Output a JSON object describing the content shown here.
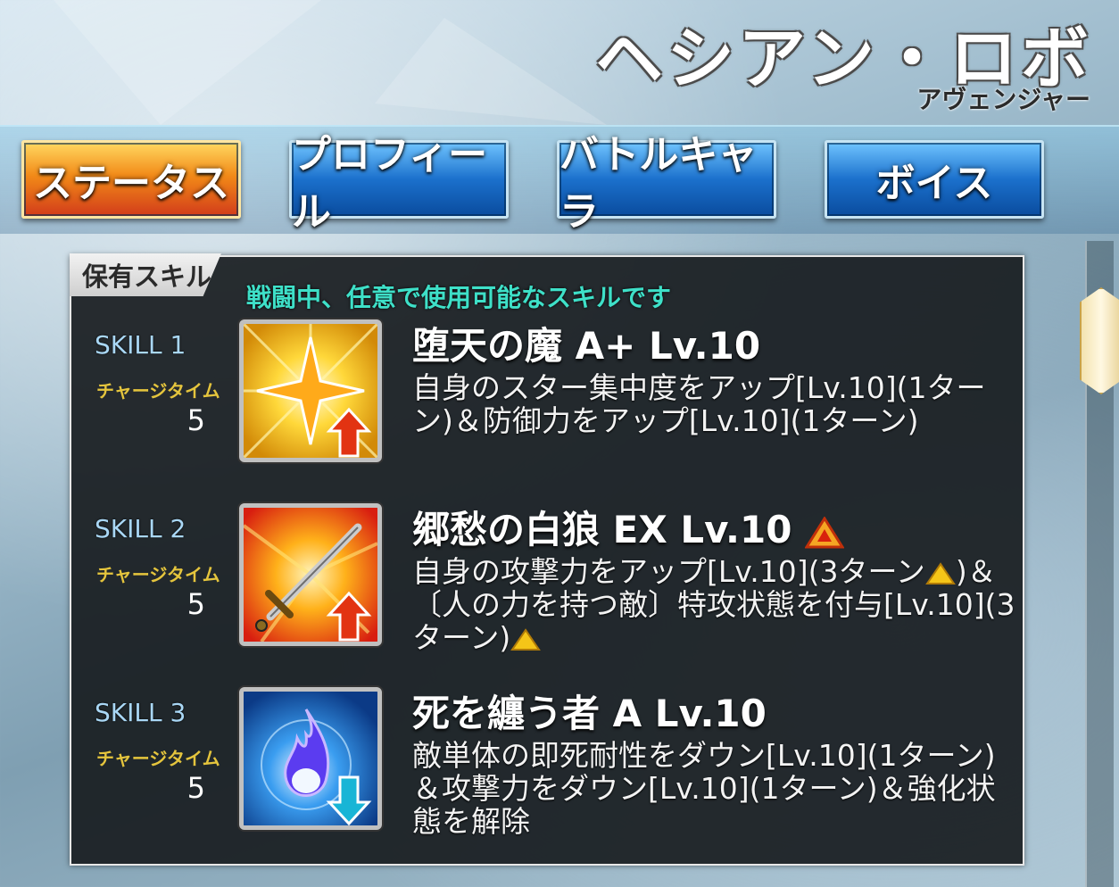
{
  "servant": {
    "name": "ヘシアン・ロボ",
    "class": "アヴェンジャー"
  },
  "tabs": [
    {
      "label": "ステータス",
      "active": true
    },
    {
      "label": "プロフィール",
      "active": false
    },
    {
      "label": "バトルキャラ",
      "active": false
    },
    {
      "label": "ボイス",
      "active": false
    }
  ],
  "panel": {
    "tab_label": "保有スキル",
    "subtitle": "戦闘中、任意で使用可能なスキルです"
  },
  "skills": [
    {
      "num": "SKILL 1",
      "ct_label": "チャージタイム",
      "ct_value": "5",
      "name": "堕天の魔 A+ Lv.10",
      "upgraded": false,
      "icon": "star-buff-up-icon",
      "desc": "自身のスター集中度をアップ[Lv.10](1ターン)＆防御力をアップ[Lv.10](1ターン)"
    },
    {
      "num": "SKILL 2",
      "ct_label": "チャージタイム",
      "ct_value": "5",
      "name": "郷愁の白狼 EX Lv.10",
      "upgraded": true,
      "icon": "sword-attack-up-icon",
      "desc_parts": [
        "自身の攻撃力をアップ[Lv.10](3ターン",
        ")＆〔人の力を持つ敵〕特攻状態を付与[Lv.10](3ターン)"
      ]
    },
    {
      "num": "SKILL 3",
      "ct_label": "チャージタイム",
      "ct_value": "5",
      "name": "死を纏う者 A Lv.10",
      "upgraded": false,
      "icon": "blue-flame-debuff-down-icon",
      "desc": "敵単体の即死耐性をダウン[Lv.10](1ターン)＆攻撃力をダウン[Lv.10](1ターン)＆強化状態を解除"
    }
  ],
  "colors": {
    "accent_active_tab": "#f28a18",
    "tab_blue": "#1b70cc",
    "subtitle_teal": "#3ee0c8",
    "charge_time_gold": "#e5c53d",
    "upgrade_marker": "#f5a623"
  }
}
